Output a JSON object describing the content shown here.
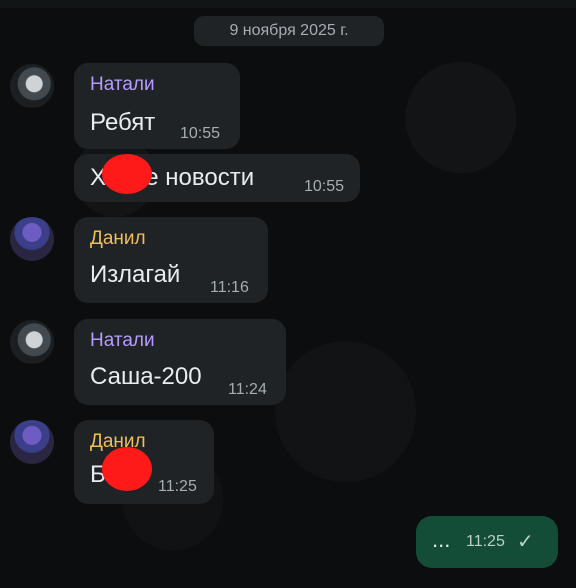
{
  "date_separator": "9 ноября 2025 г.",
  "messages": [
    {
      "sender": "Натали",
      "text": "Ребят",
      "time": "10:55"
    },
    {
      "sender": "",
      "text_left": "Х",
      "text_right": "ые новости",
      "time": "10:55"
    },
    {
      "sender": "Данил",
      "text": "Излагай",
      "time": "11:16"
    },
    {
      "sender": "Натали",
      "text": "Саша-200",
      "time": "11:24"
    },
    {
      "sender": "Данил",
      "text": "Б",
      "time": "11:25"
    }
  ],
  "outgoing": {
    "text": "...",
    "time": "11:25",
    "status_glyph": "✓"
  },
  "colors": {
    "background": "#0b0d0e",
    "incoming_bubble": "#1f2326",
    "outgoing_bubble": "#134d37",
    "natali_name": "#b79cff",
    "danil_name": "#f1bf57",
    "redaction": "#ff1a1a"
  }
}
